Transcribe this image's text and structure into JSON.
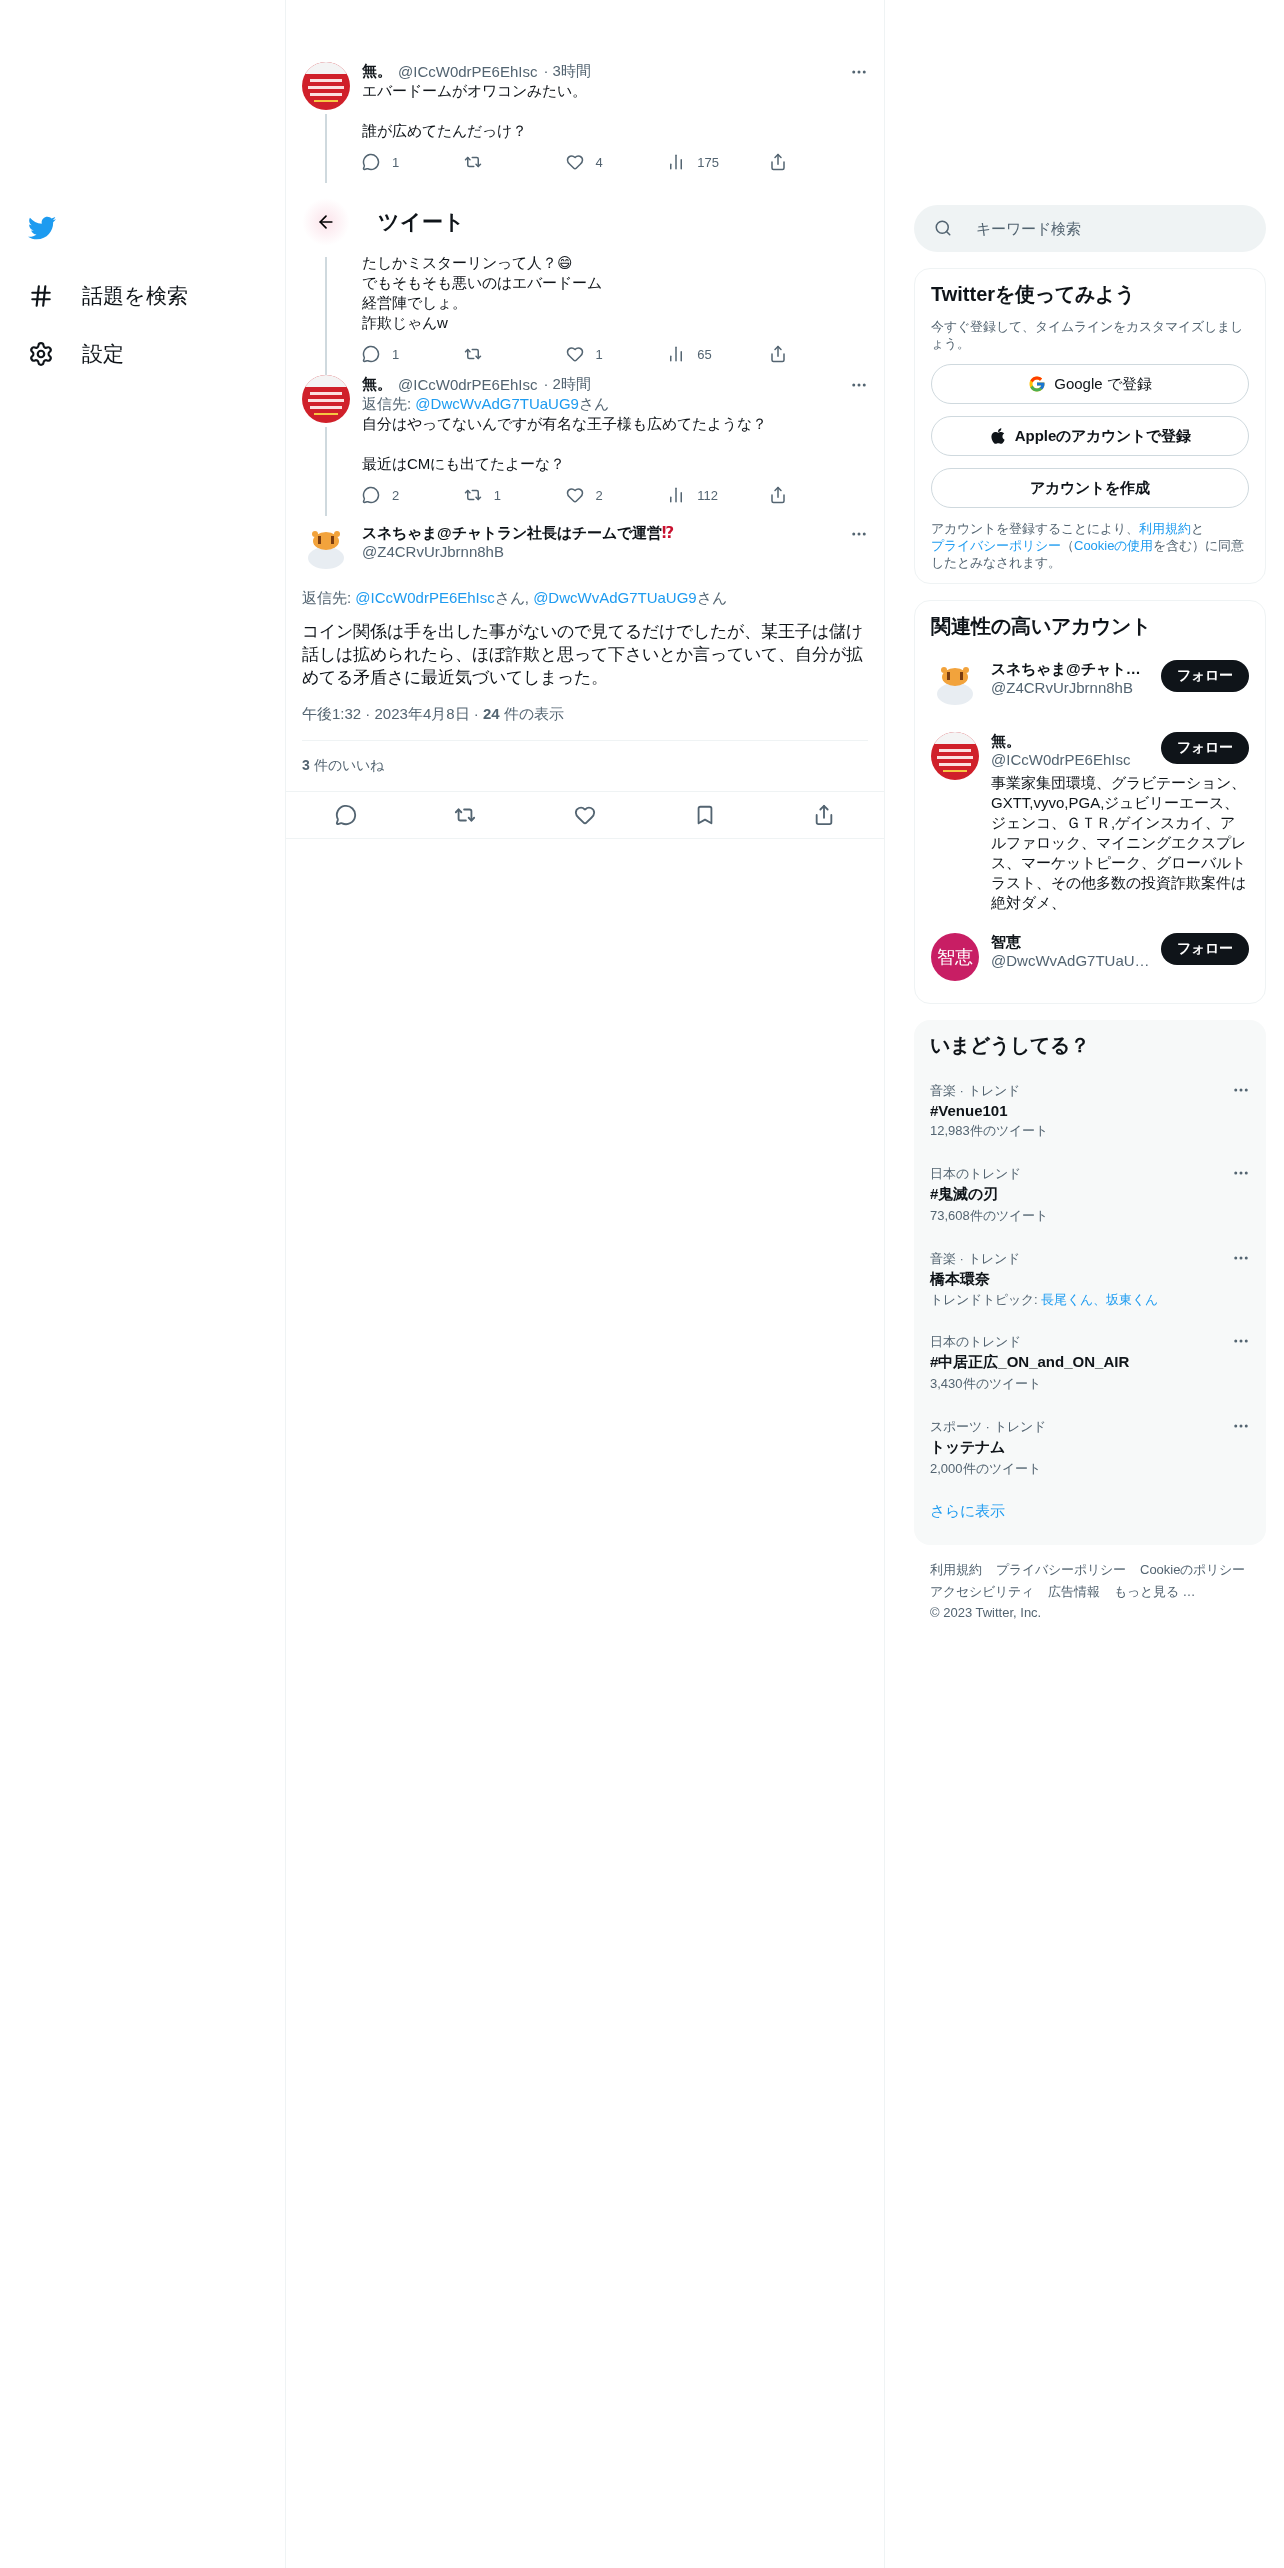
{
  "nav": {
    "items": [
      {
        "kind": "hashtag",
        "label": "話題を検索"
      },
      {
        "kind": "gear",
        "label": "設定"
      }
    ]
  },
  "thread": [
    {
      "name": "無。",
      "handle": "@ICcW0drPE6EhIsc",
      "time": "· 3時間",
      "avatar": {
        "kind": "picture"
      },
      "paragraphs": [
        [
          "エバードームがオワコンみたい。"
        ],
        [
          "誰が広めてたんだっけ？"
        ]
      ],
      "stats": {
        "reply": "1",
        "like": "4",
        "views": "175"
      }
    },
    {
      "header": "ツイート",
      "paragraphs": [
        [
          "たしかミスターリンって人？😄",
          "でもそもそも悪いのはエバードーム",
          "経営陣でしょ。",
          "詐欺じゃんw"
        ]
      ],
      "stats": {
        "reply": "1",
        "like": "1",
        "views": "65"
      }
    },
    {
      "name": "無。",
      "handle": "@ICcW0drPE6EhIsc",
      "time": "· 2時間",
      "avatar": {
        "kind": "picture"
      },
      "reply_label": "返信先:",
      "reply_mention": "@DwcWvAdG7TUaUG9",
      "reply_suffix": "さん",
      "paragraphs": [
        [
          "自分はやってないんですが有名な王子様も広めてたような？"
        ],
        [
          "最近はCMにも出てたよーな？"
        ]
      ],
      "stats": {
        "reply": "2",
        "retweet": "1",
        "like": "2",
        "views": "112"
      }
    }
  ],
  "main_tweet": {
    "name": "スネちゃま@チャトラン社長はチームで運営",
    "name_mark": "⁉",
    "handle": "@Z4CRvUrJbrnn8hB",
    "reply_label": "返信先:",
    "mentions": [
      {
        "handle": "@ICcW0drPE6EhIsc",
        "suffix": "さん,"
      },
      {
        "handle": "@DwcWvAdG7TUaUG9",
        "suffix": "さん"
      }
    ],
    "text": "コイン関係は手を出した事がないので見てるだけでしたが、某王子は儲け話しは拡められたら、ほぼ詐欺と思って下さいとか言っていて、自分が拡めてる矛盾さに最近気づいてしまった。",
    "meta": "午後1:32 · 2023年4月8日 · **24** 件の表示",
    "likes": "**3** 件のいいね"
  },
  "search": {
    "placeholder": "キーワード検索"
  },
  "signup": {
    "title": "Twitterを使ってみよう",
    "subtitle": "今すぐ登録して、タイムラインをカスタマイズしましょう。",
    "buttons": [
      {
        "kind": "google",
        "label": "Google で登録"
      },
      {
        "kind": "apple",
        "label": "Appleのアカウントで登録"
      },
      {
        "kind": "plain",
        "label": "アカウントを作成"
      }
    ],
    "legal": [
      {
        "text": "アカウントを登録することにより、",
        "link": false
      },
      {
        "text": "利用規約",
        "link": true
      },
      {
        "text": "と",
        "link": false
      },
      {
        "text": "プライバシーポリシー",
        "link": true
      },
      {
        "text": "（",
        "link": false
      },
      {
        "text": "Cookieの使用",
        "link": true
      },
      {
        "text": "を含む）に同意したとみなされます。",
        "link": false
      }
    ]
  },
  "related": {
    "title": "関連性の高いアカウント",
    "accounts": [
      {
        "avatar": {
          "kind": "tiger"
        },
        "name": "スネちゃま@チャト…",
        "handle": "@Z4CRvUrJbrnn8hB",
        "button": "フォロー"
      },
      {
        "avatar": {
          "kind": "picture"
        },
        "name": "無。",
        "handle": "@ICcW0drPE6EhIsc",
        "bio": "事業家集団環境、グラビテーション、GXTT,vyvo,PGA,ジュビリーエース、ジェンコ、ＧＴＲ,ゲインスカイ、アルファロック、マイニングエクスプレス、マーケットピーク、グローバルトラスト、その他多数の投資詐欺案件は絶対ダメ、",
        "button": "フォロー"
      },
      {
        "avatar": {
          "kind": "text",
          "text": "智恵"
        },
        "name": "智恵",
        "handle": "@DwcWvAdG7TUaU…",
        "button": "フォロー"
      }
    ]
  },
  "trends": {
    "title": "いまどうしてる？",
    "items": [
      {
        "category": "音楽 · トレンド",
        "title": "#Venue101",
        "count": "12,983件のツイート"
      },
      {
        "category": "日本のトレンド",
        "title": "#鬼滅の刃",
        "count": "73,608件のツイート"
      },
      {
        "category": "音楽 · トレンド",
        "title": "橋本環奈",
        "topic_label": "トレンドトピック:",
        "topics": "長尾くん、坂東くん"
      },
      {
        "category": "日本のトレンド",
        "title": "#中居正広_ON_and_ON_AIR",
        "count": "3,430件のツイート"
      },
      {
        "category": "スポーツ · トレンド",
        "title": "トッテナム",
        "count": "2,000件のツイート"
      }
    ],
    "more": "さらに表示"
  },
  "footer": {
    "links": [
      "利用規約",
      "プライバシーポリシー",
      "Cookieのポリシー",
      "アクセシビリティ",
      "広告情報",
      "もっと見る …"
    ],
    "copyright": "© 2023 Twitter, Inc."
  }
}
